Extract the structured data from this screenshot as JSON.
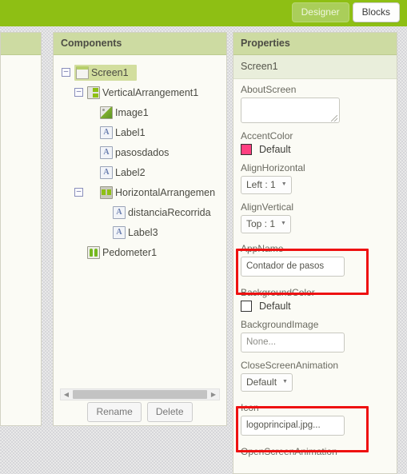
{
  "topbar": {
    "designer_label": "Designer",
    "blocks_label": "Blocks",
    "bar_color": "#8ebf14",
    "active_tab": "Designer"
  },
  "components_panel": {
    "title": "Components",
    "tree": [
      {
        "label": "Screen1",
        "icon": "screen-icon",
        "depth": 0,
        "expandable": true,
        "selected": true
      },
      {
        "label": "VerticalArrangement1",
        "icon": "vertical-arrangement-icon",
        "depth": 1,
        "expandable": true,
        "selected": false
      },
      {
        "label": "Image1",
        "icon": "image-icon",
        "depth": 2,
        "expandable": false,
        "selected": false
      },
      {
        "label": "Label1",
        "icon": "label-icon",
        "depth": 2,
        "expandable": false,
        "selected": false
      },
      {
        "label": "pasosdados",
        "icon": "label-icon",
        "depth": 2,
        "expandable": false,
        "selected": false
      },
      {
        "label": "Label2",
        "icon": "label-icon",
        "depth": 2,
        "expandable": false,
        "selected": false
      },
      {
        "label": "HorizontalArrangemen",
        "icon": "horizontal-arrangement-icon",
        "depth": 2,
        "expandable": true,
        "selected": false
      },
      {
        "label": "distanciaRecorrida",
        "icon": "label-icon",
        "depth": 3,
        "expandable": false,
        "selected": false
      },
      {
        "label": "Label3",
        "icon": "label-icon",
        "depth": 3,
        "expandable": false,
        "selected": false
      },
      {
        "label": "Pedometer1",
        "icon": "pedometer-icon",
        "depth": 1,
        "expandable": false,
        "selected": false
      }
    ],
    "rename_label": "Rename",
    "delete_label": "Delete"
  },
  "properties_panel": {
    "title": "Properties",
    "selected_component": "Screen1",
    "properties": [
      {
        "name": "AboutScreen",
        "kind": "textarea",
        "value": ""
      },
      {
        "name": "AccentColor",
        "kind": "color",
        "value": "Default",
        "color": "#ff4081"
      },
      {
        "name": "AlignHorizontal",
        "kind": "select",
        "value": "Left : 1"
      },
      {
        "name": "AlignVertical",
        "kind": "select",
        "value": "Top : 1"
      },
      {
        "name": "AppName",
        "kind": "text",
        "value": "Contador de pasos",
        "highlighted": true
      },
      {
        "name": "BackgroundColor",
        "kind": "color",
        "value": "Default",
        "color": "#ffffff"
      },
      {
        "name": "BackgroundImage",
        "kind": "text",
        "value": "None...",
        "placeholder": true
      },
      {
        "name": "CloseScreenAnimation",
        "kind": "select",
        "value": "Default"
      },
      {
        "name": "Icon",
        "kind": "text",
        "value": "logoprincipal.jpg...",
        "highlighted": true
      },
      {
        "name": "OpenScreenAnimation",
        "kind": "label-only",
        "value": ""
      }
    ]
  }
}
